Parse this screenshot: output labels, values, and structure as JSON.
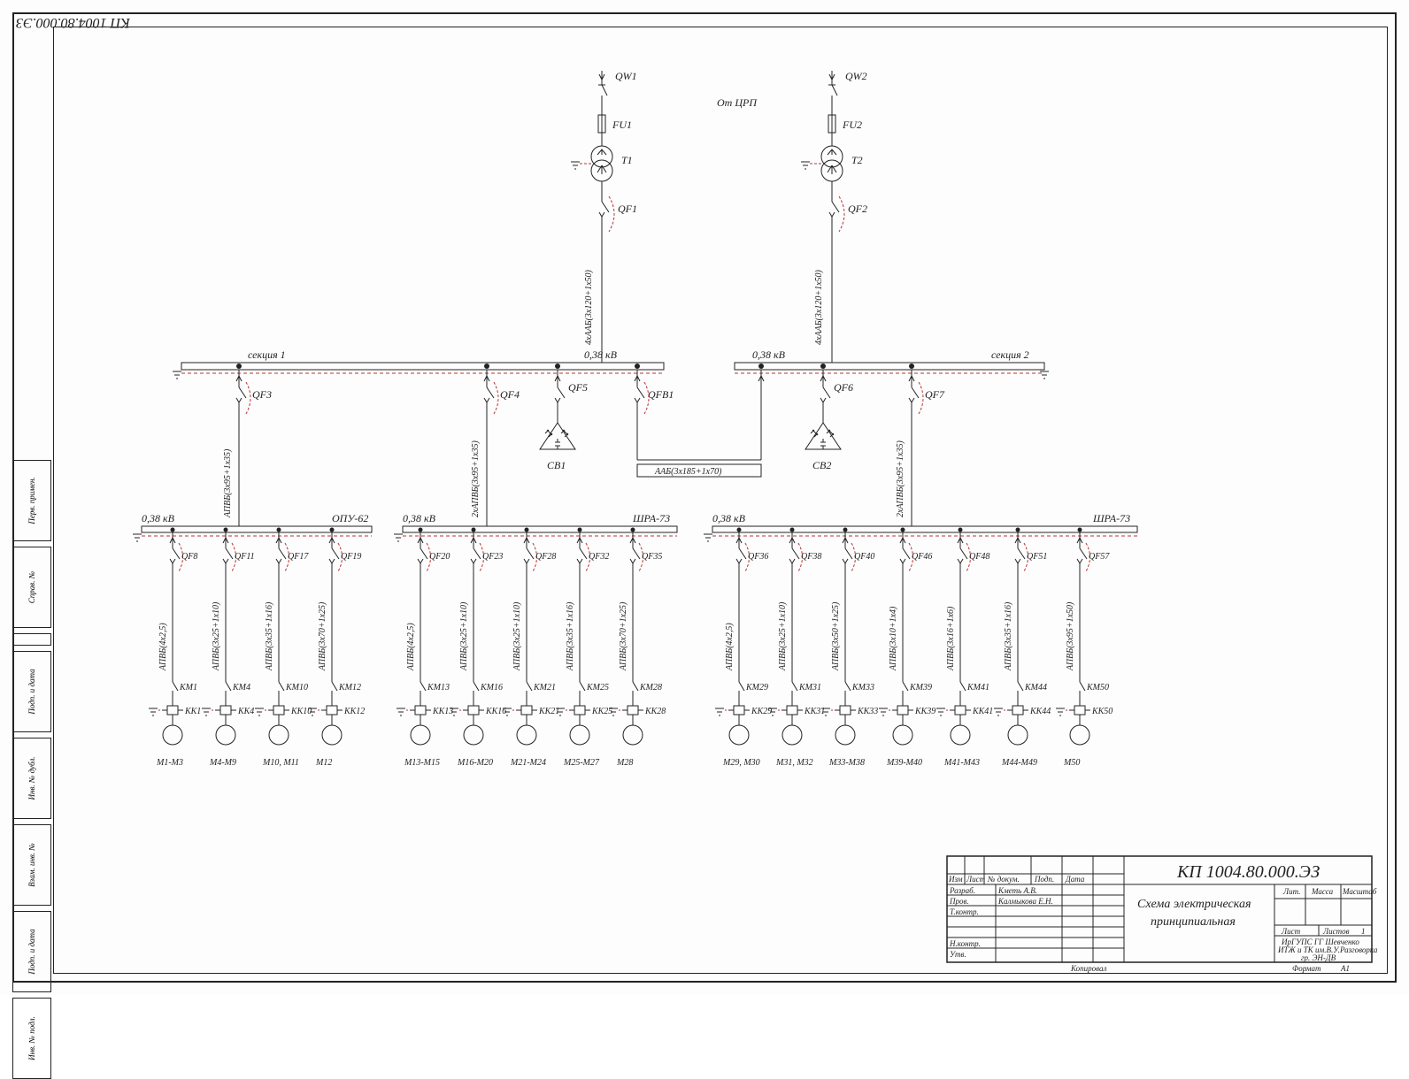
{
  "drawing_number": "КП 1004.80.000.ЭЗ",
  "title_line1": "Схема электрическая",
  "title_line2": "принципиальная",
  "source_label": "От ЦРП",
  "voltage": "0,38 кВ",
  "section1": "секция 1",
  "section2": "секция 2",
  "tie_cable": "ААБ(3х185+1х70)",
  "incomers": [
    {
      "qw": "QW1",
      "fu": "FU1",
      "t": "T1",
      "qf": "QF1",
      "cable": "4хААБ(3х120+1х50)"
    },
    {
      "qw": "QW2",
      "fu": "FU2",
      "t": "T2",
      "qf": "QF2",
      "cable": "4хААБ(3х120+1х50)"
    }
  ],
  "main_feeders": {
    "qf3": {
      "label": "QF3",
      "cable": "АПВБ(3х95+1х35)"
    },
    "qf4": {
      "label": "QF4",
      "cable": "2хАПВБ(3х95+1х35)"
    },
    "qf5": {
      "label": "QF5"
    },
    "qfb1": {
      "label": "QFB1"
    },
    "qf6": {
      "label": "QF6"
    },
    "qf7": {
      "label": "QF7",
      "cable": "2хАПВБ(3х95+1х35)"
    }
  },
  "caps": {
    "cb1": "СВ1",
    "cb2": "СВ2"
  },
  "panels": {
    "p1": {
      "name": "ОПУ-62",
      "v": "0,38 кВ"
    },
    "p2": {
      "name": "ШРА-73",
      "v": "0,38 кВ"
    },
    "p3": {
      "name": "ШРА-73",
      "v": "0,38 кВ"
    }
  },
  "loads": [
    {
      "qf": "QF8",
      "cable": "АПВБ(4х2,5)",
      "km": "КМ1",
      "kk": "КК1",
      "m": "М1-М3"
    },
    {
      "qf": "QF11",
      "cable": "АПВБ(3х25+1х10)",
      "km": "КМ4",
      "kk": "КК4",
      "m": "М4-М9"
    },
    {
      "qf": "QF17",
      "cable": "АПВБ(3х35+1х16)",
      "km": "КМ10",
      "kk": "КК10",
      "m": "М10, М11"
    },
    {
      "qf": "QF19",
      "cable": "АПВБ(3х70+1х25)",
      "km": "КМ12",
      "kk": "КК12",
      "m": "М12"
    },
    {
      "qf": "QF20",
      "cable": "АПВБ(4х2,5)",
      "km": "КМ13",
      "kk": "КК13",
      "m": "М13-М15"
    },
    {
      "qf": "QF23",
      "cable": "АПВБ(3х25+1х10)",
      "km": "КМ16",
      "kk": "КК16",
      "m": "М16-М20"
    },
    {
      "qf": "QF28",
      "cable": "АПВБ(3х25+1х10)",
      "km": "КМ21",
      "kk": "КК21",
      "m": "М21-М24"
    },
    {
      "qf": "QF32",
      "cable": "АПВБ(3х35+1х16)",
      "km": "КМ25",
      "kk": "КК25",
      "m": "М25-М27"
    },
    {
      "qf": "QF35",
      "cable": "АПВБ(3х70+1х25)",
      "km": "КМ28",
      "kk": "КК28",
      "m": "М28"
    },
    {
      "qf": "QF36",
      "cable": "АПВБ(4х2,5)",
      "km": "КМ29",
      "kk": "КК29",
      "m": "М29, М30"
    },
    {
      "qf": "QF38",
      "cable": "АПВБ(3х25+1х10)",
      "km": "КМ31",
      "kk": "КК31",
      "m": "М31, М32"
    },
    {
      "qf": "QF40",
      "cable": "АПВБ(3х50+1х25)",
      "km": "КМ33",
      "kk": "КК33",
      "m": "М33-М38"
    },
    {
      "qf": "QF46",
      "cable": "АПВБ(3х10+1х4)",
      "km": "КМ39",
      "kk": "КК39",
      "m": "М39-М40"
    },
    {
      "qf": "QF48",
      "cable": "АПВБ(3х16+1х6)",
      "km": "КМ41",
      "kk": "КК41",
      "m": "М41-М43"
    },
    {
      "qf": "QF51",
      "cable": "АПВБ(3х35+1х16)",
      "km": "КМ44",
      "kk": "КК44",
      "m": "М44-М49"
    },
    {
      "qf": "QF57",
      "cable": "АПВБ(3х95+1х50)",
      "km": "КМ50",
      "kk": "КК50",
      "m": "М50"
    }
  ],
  "titleblock": {
    "rows": [
      "Изм",
      "Лист",
      "№ докум.",
      "Подп.",
      "Дата"
    ],
    "roles": [
      {
        "r": "Разраб.",
        "n": "Кметь А.В."
      },
      {
        "r": "Пров.",
        "n": "Калмыкова Е.Н."
      },
      {
        "r": "Т.контр.",
        "n": ""
      },
      {
        "r": "Н.контр.",
        "n": ""
      },
      {
        "r": "Утв.",
        "n": ""
      }
    ],
    "lit": "Лит.",
    "mass": "Масса",
    "scale": "Масштаб",
    "sheet": "Лист",
    "sheets": "Листов",
    "sheets_n": "1",
    "org1": "ИрГУПС  ГГ Шевченко",
    "org2": "ИТЖ и ТК им.В.У.Разговорка",
    "org3": "гр. ЭН-ДВ",
    "copy": "Копировал",
    "format": "Формат",
    "format_v": "А1"
  },
  "side": [
    "Инв. № подл.",
    "Подп. и дата",
    "Взам. инв. №",
    "Инв. № дубл.",
    "Подп. и дата",
    "Справ. №",
    "Перв. примен."
  ]
}
